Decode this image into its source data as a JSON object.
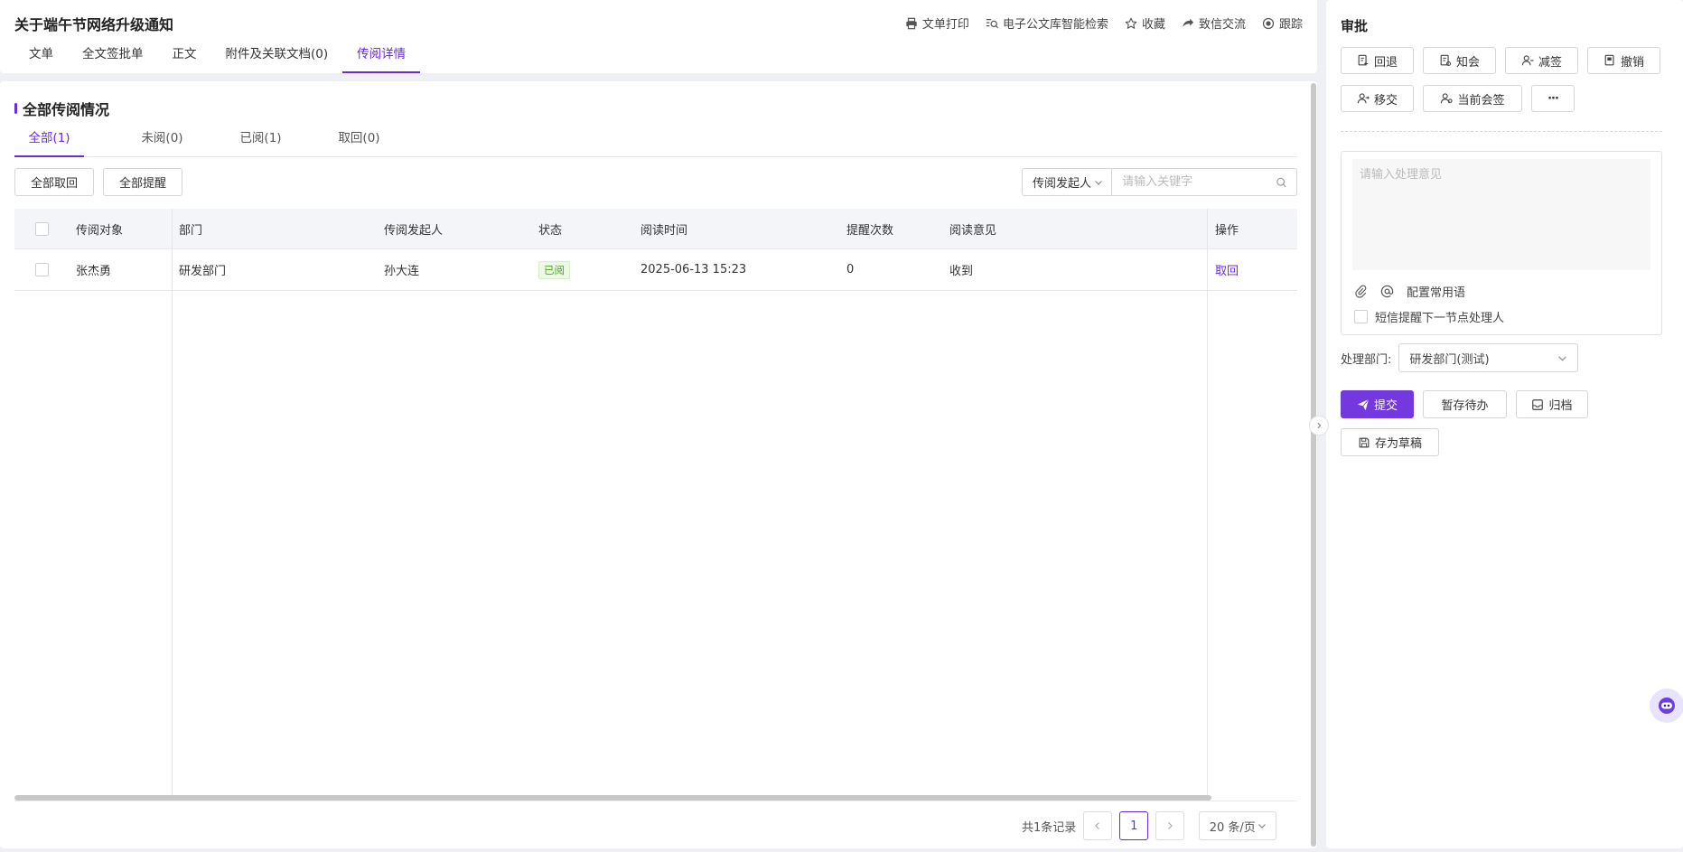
{
  "header": {
    "title": "关于端午节网络升级通知",
    "actions": [
      {
        "label": "文单打印",
        "icon": "printer-icon"
      },
      {
        "label": "电子公文库智能检索",
        "icon": "search-list-icon"
      },
      {
        "label": "收藏",
        "icon": "star-icon"
      },
      {
        "label": "致信交流",
        "icon": "chat-icon"
      },
      {
        "label": "跟踪",
        "icon": "target-icon"
      }
    ],
    "tabs": [
      "文单",
      "全文签批单",
      "正文",
      "附件及关联文档(0)",
      "传阅详情"
    ],
    "active_tab": "传阅详情"
  },
  "main": {
    "section_title": "全部传阅情况",
    "sub_tabs": [
      "全部(1)",
      "未阅(0)",
      "已阅(1)",
      "取回(0)"
    ],
    "active_sub_tab": "全部(1)",
    "buttons": {
      "recall_all": "全部取回",
      "remind_all": "全部提醒"
    },
    "search": {
      "select_label": "传阅发起人",
      "placeholder": "请输入关键字"
    },
    "table": {
      "columns": [
        "传阅对象",
        "部门",
        "传阅发起人",
        "状态",
        "阅读时间",
        "提醒次数",
        "阅读意见",
        "操作"
      ],
      "rows": [
        {
          "target": "张杰勇",
          "dept": "研发部门",
          "initiator": "孙大连",
          "status": "已阅",
          "read_time": "2025-06-13 15:23",
          "remind_count": "0",
          "opinion": "收到",
          "action": "取回"
        }
      ]
    },
    "pagination": {
      "total": "共1条记录",
      "current": "1",
      "page_size": "20 条/页"
    }
  },
  "approval": {
    "title": "审批",
    "buttons": [
      {
        "label": "回退",
        "icon": "rollback-icon"
      },
      {
        "label": "知会",
        "icon": "notify-icon"
      },
      {
        "label": "减签",
        "icon": "remove-signer-icon"
      },
      {
        "label": "撤销",
        "icon": "revoke-icon"
      },
      {
        "label": "移交",
        "icon": "transfer-icon"
      },
      {
        "label": "当前会签",
        "icon": "countersign-icon"
      },
      {
        "label": "···",
        "icon": "more-icon"
      }
    ],
    "opinion_placeholder": "请输入处理意见",
    "config_phrases": "配置常用语",
    "sms_remind": "短信提醒下一节点处理人",
    "dept_label": "处理部门:",
    "dept_value": "研发部门(测试)",
    "actions": {
      "submit": "提交",
      "save_pending": "暂存待办",
      "archive": "归档",
      "save_draft": "存为草稿"
    }
  },
  "colors": {
    "accent": "#7438df",
    "status_read": "#52a32a"
  }
}
